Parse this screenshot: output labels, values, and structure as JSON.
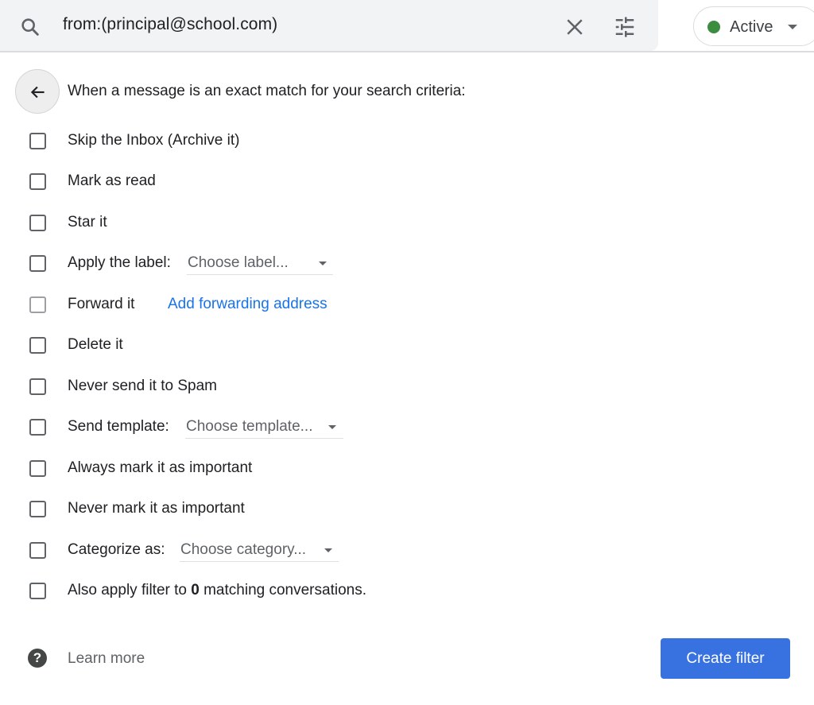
{
  "search": {
    "query": "from:(principal@school.com)",
    "search_icon": "search-icon",
    "clear_icon": "close-icon",
    "options_icon": "tune-icon"
  },
  "status": {
    "label": "Active",
    "dot_color": "#3c8d40"
  },
  "filter": {
    "back_icon": "arrow-back-icon",
    "intro": "When a message is an exact match for your search criteria:",
    "options": [
      {
        "label": "Skip the Inbox (Archive it)",
        "checked": false
      },
      {
        "label": "Mark as read",
        "checked": false
      },
      {
        "label": "Star it",
        "checked": false
      },
      {
        "label": "Apply the label:",
        "checked": false,
        "dropdown": "Choose label..."
      },
      {
        "label": "Forward it",
        "checked": false,
        "disabled": true,
        "link": "Add forwarding address"
      },
      {
        "label": "Delete it",
        "checked": false
      },
      {
        "label": "Never send it to Spam",
        "checked": false
      },
      {
        "label": "Send template:",
        "checked": false,
        "dropdown": "Choose template..."
      },
      {
        "label": "Always mark it as important",
        "checked": false
      },
      {
        "label": "Never mark it as important",
        "checked": false
      },
      {
        "label": "Categorize as:",
        "checked": false,
        "dropdown": "Choose category..."
      },
      {
        "label_prefix": "Also apply filter to",
        "count": "0",
        "label_suffix": "matching conversations.",
        "checked": false
      }
    ]
  },
  "footer": {
    "help_icon": "help-icon",
    "help_glyph": "?",
    "learn_more": "Learn more",
    "create_button": "Create filter",
    "accent_color": "#3872e0"
  }
}
